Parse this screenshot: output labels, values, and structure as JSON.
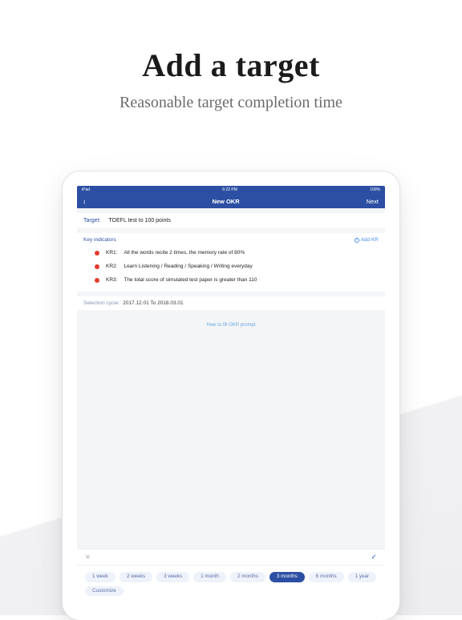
{
  "headline": {
    "title": "Add a target",
    "subtitle": "Reasonable target completion time"
  },
  "status": {
    "left": "iPad",
    "center": "6:22 PM",
    "right": "100%"
  },
  "nav": {
    "back": "‹",
    "title": "New OKR",
    "next": "Next"
  },
  "target": {
    "label": "Target:",
    "value": "TOEFL test to 100 points"
  },
  "ki": {
    "header": "Key indicators",
    "add": "Add KR"
  },
  "kr": {
    "items": [
      {
        "label": "KR1:",
        "text": "All the words recite 2 times, the memory rate of 80%"
      },
      {
        "label": "KR2:",
        "text": "Learn Listening / Reading / Speaking / Writing everyday"
      },
      {
        "label": "KR3:",
        "text": "The total score of simulated test paper is greater than 110"
      }
    ]
  },
  "cycle": {
    "label": "Selection cycle:",
    "value": "2017.12.01 To 2018.03.01"
  },
  "prompt": "How to fill OKR prompt",
  "chips": {
    "items": [
      {
        "label": "1 week",
        "selected": false
      },
      {
        "label": "2 weeks",
        "selected": false
      },
      {
        "label": "3 weeks",
        "selected": false
      },
      {
        "label": "1 month",
        "selected": false
      },
      {
        "label": "2 months",
        "selected": false
      },
      {
        "label": "3 months",
        "selected": true
      },
      {
        "label": "6 months",
        "selected": false
      },
      {
        "label": "1 year",
        "selected": false
      },
      {
        "label": "Customize",
        "selected": false
      }
    ]
  }
}
